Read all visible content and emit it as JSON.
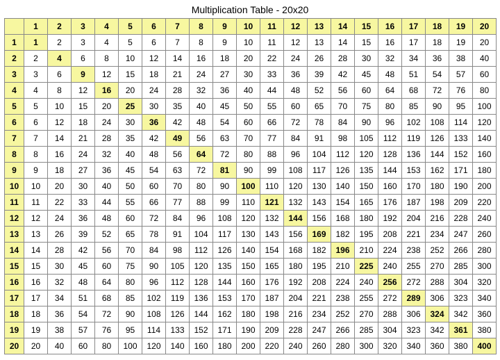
{
  "title": "Multiplication Table - 20x20",
  "chart_data": {
    "type": "table",
    "title": "Multiplication Table - 20x20",
    "size": 20,
    "row_headers": [
      1,
      2,
      3,
      4,
      5,
      6,
      7,
      8,
      9,
      10,
      11,
      12,
      13,
      14,
      15,
      16,
      17,
      18,
      19,
      20
    ],
    "col_headers": [
      1,
      2,
      3,
      4,
      5,
      6,
      7,
      8,
      9,
      10,
      11,
      12,
      13,
      14,
      15,
      16,
      17,
      18,
      19,
      20
    ],
    "squares": [
      1,
      4,
      9,
      16,
      25,
      36,
      49,
      64,
      81,
      100,
      121,
      144,
      169,
      196,
      225,
      256,
      289,
      324,
      361,
      400
    ]
  }
}
